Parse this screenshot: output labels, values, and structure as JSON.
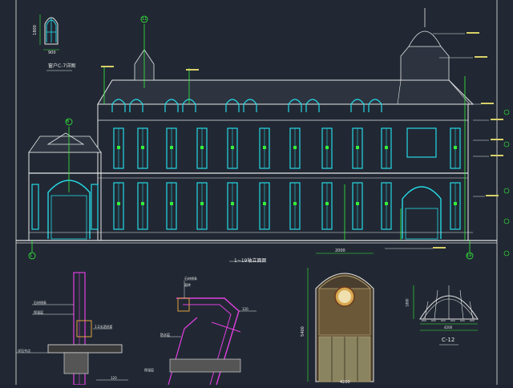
{
  "drawing": {
    "background": "#212833",
    "line_color": "#e6e6e6",
    "window_color": "#25d9e6",
    "accent_green": "#34f03a",
    "magenta": "#e040e0",
    "orange": "#e0a040"
  },
  "elevation": {
    "caption": "1~19轴立面图",
    "axis_start": "1",
    "axis_end": "19",
    "axis_mid_top": "11",
    "axis_mid": "8"
  },
  "window_detail": {
    "caption": "窗户C-7详图",
    "width_dim": "900",
    "height_dim": "1800"
  },
  "door_detail": {
    "height_dim": "5400",
    "top_dim": "2000",
    "width_dim": "4200"
  },
  "arch_detail": {
    "caption": "C-12",
    "dims": [
      "600",
      "600",
      "600",
      "600",
      "600",
      "600"
    ],
    "total_width": "4200",
    "height_dim": "1800"
  },
  "section_left": {
    "labels": [
      "石材线条",
      "保温层",
      "1:2水泥砂浆",
      "详见节点",
      "120",
      "120"
    ]
  },
  "section_mid": {
    "labels": [
      "石材线条",
      "面砖",
      "防水层",
      "保温层",
      "120"
    ]
  }
}
